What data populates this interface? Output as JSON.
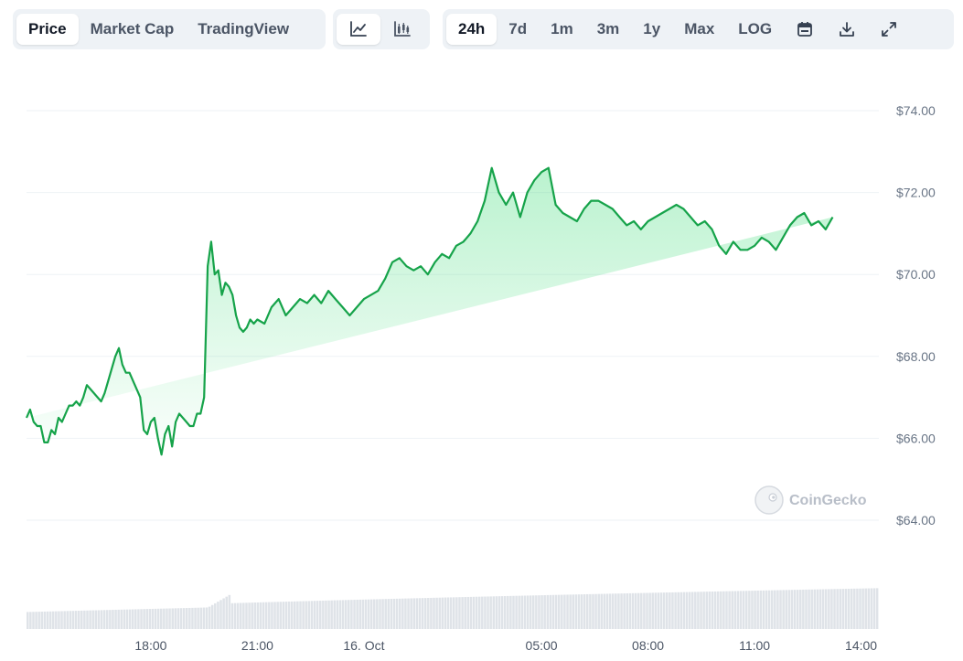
{
  "toolbar": {
    "metric_tabs": [
      {
        "label": "Price",
        "active": true
      },
      {
        "label": "Market Cap",
        "active": false
      },
      {
        "label": "TradingView",
        "active": false
      }
    ],
    "chart_style_icons": [
      "line-chart-icon",
      "candlestick-chart-icon"
    ],
    "ranges": [
      {
        "label": "24h",
        "active": true
      },
      {
        "label": "7d",
        "active": false
      },
      {
        "label": "1m",
        "active": false
      },
      {
        "label": "3m",
        "active": false
      },
      {
        "label": "1y",
        "active": false
      },
      {
        "label": "Max",
        "active": false
      },
      {
        "label": "LOG",
        "active": false
      }
    ],
    "tool_icons": [
      "calendar-icon",
      "download-icon",
      "expand-icon"
    ]
  },
  "watermark": "CoinGecko",
  "colors": {
    "line": "#16a34a",
    "fill": "#4ade80",
    "volume": "#dfe3e8",
    "grid": "#eef2f6"
  },
  "chart_data": {
    "type": "area",
    "title": "",
    "xlabel": "",
    "ylabel": "",
    "ylim": [
      64,
      74.4
    ],
    "y_ticks": [
      "$74.00",
      "$72.00",
      "$70.00",
      "$68.00",
      "$66.00",
      "$64.00"
    ],
    "y_tick_values": [
      74,
      72,
      70,
      68,
      66,
      64
    ],
    "x_ticks": [
      "18:00",
      "21:00",
      "16. Oct",
      "05:00",
      "08:00",
      "11:00",
      "14:00"
    ],
    "x_tick_hours": [
      18,
      21,
      24,
      29,
      32,
      35,
      38
    ],
    "xlim_hours": [
      14.5,
      38.5
    ],
    "grid": true,
    "series": [
      {
        "x_hours": [
          14.5,
          14.6,
          14.7,
          14.8,
          14.9,
          15.0,
          15.1,
          15.2,
          15.3,
          15.4,
          15.5,
          15.6,
          15.7,
          15.8,
          15.9,
          16.0,
          16.1,
          16.2,
          16.3,
          16.4,
          16.5,
          16.6,
          16.7,
          16.8,
          16.9,
          17.0,
          17.1,
          17.2,
          17.3,
          17.4,
          17.5,
          17.6,
          17.7,
          17.8,
          17.9,
          18.0,
          18.1,
          18.2,
          18.3,
          18.4,
          18.5,
          18.6,
          18.7,
          18.8,
          18.9,
          19.0,
          19.1,
          19.2,
          19.3,
          19.4,
          19.5,
          19.6,
          19.7,
          19.8,
          19.9,
          20.0,
          20.1,
          20.2,
          20.3,
          20.4,
          20.5,
          20.6,
          20.7,
          20.8,
          20.9,
          21.0,
          21.2,
          21.4,
          21.6,
          21.8,
          22.0,
          22.2,
          22.4,
          22.6,
          22.8,
          23.0,
          23.2,
          23.4,
          23.6,
          23.8,
          24.0,
          24.2,
          24.4,
          24.6,
          24.8,
          25.0,
          25.2,
          25.4,
          25.6,
          25.8,
          26.0,
          26.2,
          26.4,
          26.6,
          26.8,
          27.0,
          27.2,
          27.4,
          27.6,
          27.8,
          28.0,
          28.2,
          28.4,
          28.6,
          28.8,
          29.0,
          29.2,
          29.4,
          29.6,
          29.8,
          30.0,
          30.2,
          30.4,
          30.6,
          30.8,
          31.0,
          31.2,
          31.4,
          31.6,
          31.8,
          32.0,
          32.2,
          32.4,
          32.6,
          32.8,
          33.0,
          33.2,
          33.4,
          33.6,
          33.8,
          34.0,
          34.2,
          34.4,
          34.6,
          34.8,
          35.0,
          35.2,
          35.4,
          35.6,
          35.8,
          36.0,
          36.2,
          36.4,
          36.6,
          36.8,
          37.0,
          37.2,
          37.4,
          37.6,
          37.8,
          38.0,
          38.2,
          38.4,
          38.5
        ],
        "price": [
          66.5,
          66.7,
          66.4,
          66.3,
          66.3,
          65.9,
          65.9,
          66.2,
          66.1,
          66.5,
          66.4,
          66.6,
          66.8,
          66.8,
          66.9,
          66.8,
          67.0,
          67.3,
          67.2,
          67.1,
          67.0,
          66.9,
          67.1,
          67.4,
          67.7,
          68.0,
          68.2,
          67.8,
          67.6,
          67.6,
          67.4,
          67.2,
          67.0,
          66.2,
          66.1,
          66.4,
          66.5,
          66.0,
          65.6,
          66.1,
          66.3,
          65.8,
          66.4,
          66.6,
          66.5,
          66.4,
          66.3,
          66.3,
          66.6,
          66.6,
          67.0,
          70.2,
          70.8,
          70.0,
          70.1,
          69.5,
          69.8,
          69.7,
          69.5,
          69.0,
          68.7,
          68.6,
          68.7,
          68.9,
          68.8,
          68.9,
          68.8,
          69.2,
          69.4,
          69.0,
          69.2,
          69.4,
          69.3,
          69.5,
          69.3,
          69.6,
          69.4,
          69.2,
          69.0,
          69.2,
          69.4,
          69.5,
          69.6,
          69.9,
          70.3,
          70.4,
          70.2,
          70.1,
          70.2,
          70.0,
          70.3,
          70.5,
          70.4,
          70.7,
          70.8,
          71.0,
          71.3,
          71.8,
          72.6,
          72.0,
          71.7,
          72.0,
          71.4,
          72.0,
          72.3,
          72.5,
          72.6,
          71.7,
          71.5,
          71.4,
          71.3,
          71.6,
          71.8,
          71.8,
          71.7,
          71.6,
          71.4,
          71.2,
          71.3,
          71.1,
          71.3,
          71.4,
          71.5,
          71.6,
          71.7,
          71.6,
          71.4,
          71.2,
          71.3,
          71.1,
          70.7,
          70.5,
          70.8,
          70.6,
          70.6,
          70.7,
          70.9,
          70.8,
          70.6,
          70.9,
          71.2,
          71.4,
          71.5,
          71.2,
          71.3,
          71.1,
          71.4
        ],
        "volume_start": 0.3,
        "volume_end": 0.72
      }
    ]
  }
}
